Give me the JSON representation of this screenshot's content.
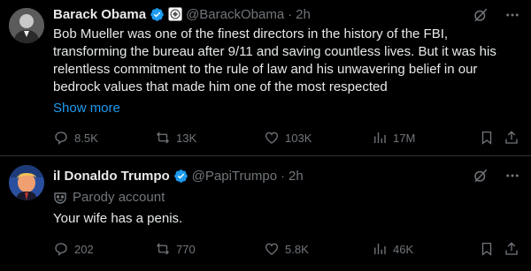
{
  "tweets": [
    {
      "author_name": "Barack Obama",
      "handle": "@BarackObama",
      "separator": "·",
      "time": "2h",
      "text": "Bob Mueller was one of the finest directors in the history of the FBI, transforming the bureau after 9/11 and saving countless lives. But it was his relentless commitment to the rule of law and his unwavering belief in our bedrock values that made him one of the most respected",
      "show_more": "Show more",
      "replies": "8.5K",
      "reposts": "13K",
      "likes": "103K",
      "views": "17M",
      "verified_icon": "verified-badge-icon",
      "affiliation_icon": "government-badge-icon"
    },
    {
      "author_name": "il Donaldo Trumpo",
      "handle": "@PapiTrumpo",
      "separator": "·",
      "time": "2h",
      "parody_label": "Parody account",
      "text": "Your wife has a penis.",
      "replies": "202",
      "reposts": "770",
      "likes": "5.8K",
      "views": "46K",
      "verified_icon": "verified-badge-icon"
    }
  ],
  "colors": {
    "background": "#000000",
    "text": "#e7e9ea",
    "muted": "#71767b",
    "accent": "#1d9bf0",
    "divider": "#2f3336"
  }
}
